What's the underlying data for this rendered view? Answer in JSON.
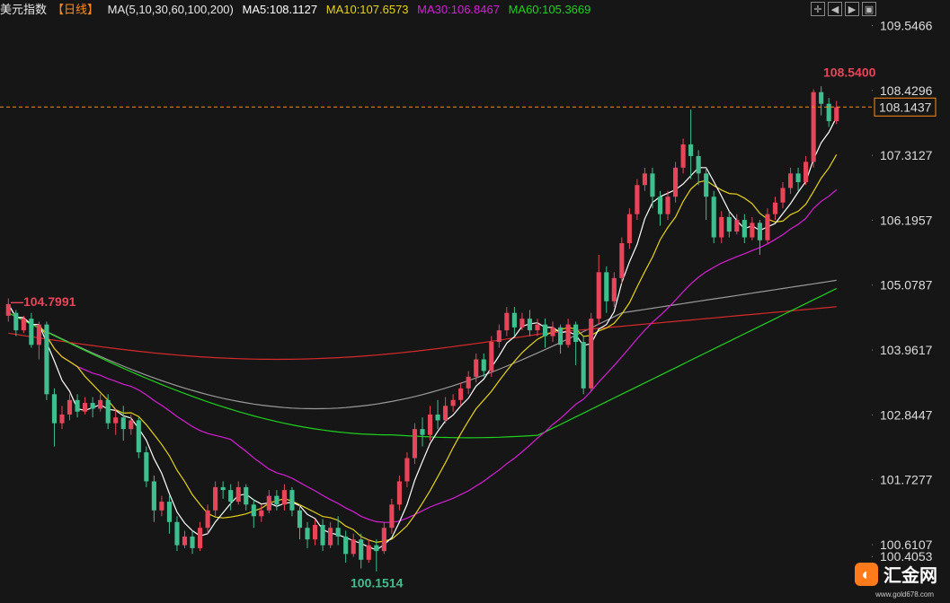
{
  "header": {
    "title": "美元指数",
    "period": "【日线】",
    "ma_label": "MA(5,10,30,60,100,200)",
    "ma5": "MA5:108.1127",
    "ma10": "MA10:107.6573",
    "ma30": "MA30:106.8467",
    "ma60": "MA60:105.3669",
    "colors": {
      "ma5": "#ffffff",
      "ma10": "#e6d21a",
      "ma30": "#d61fd6",
      "ma60": "#1fd11f"
    }
  },
  "toolbar": [
    "crosshair-icon",
    "bar-back-icon",
    "bar-forward-icon",
    "window-icon"
  ],
  "logo": {
    "name": "汇金网",
    "url": "www.gold678.com"
  },
  "chart_data": {
    "type": "candlestick",
    "yticks": [
      "109.5466",
      "108.4296",
      "107.3127",
      "106.1957",
      "105.0787",
      "103.9617",
      "102.8447",
      "101.7277",
      "100.6107",
      "100.4053"
    ],
    "ylim": [
      100.1,
      109.6
    ],
    "current_price": "108.1437",
    "annotations": {
      "high": "108.5400",
      "low": "100.1514",
      "left_high": "104.7991"
    },
    "colors": {
      "up": "#e8455a",
      "down": "#3fbf8f",
      "ma100": "#d42a2a",
      "ma200": "#9a9a9a",
      "price_line": "#ff8c1a"
    },
    "candles": [
      [
        104.55,
        104.75,
        104.45,
        104.85
      ],
      [
        104.6,
        104.3,
        104.2,
        104.65
      ],
      [
        104.3,
        104.5,
        104.25,
        104.55
      ],
      [
        104.5,
        104.05,
        104.0,
        104.6
      ],
      [
        104.05,
        104.4,
        103.8,
        104.45
      ],
      [
        104.4,
        103.2,
        103.1,
        104.45
      ],
      [
        103.2,
        102.7,
        102.3,
        103.3
      ],
      [
        102.7,
        102.85,
        102.6,
        103.0
      ],
      [
        102.85,
        103.1,
        102.75,
        103.2
      ],
      [
        103.1,
        102.9,
        102.8,
        103.2
      ],
      [
        102.9,
        103.05,
        102.85,
        103.15
      ],
      [
        103.05,
        102.95,
        102.8,
        103.15
      ],
      [
        102.95,
        103.1,
        102.9,
        103.2
      ],
      [
        103.1,
        102.7,
        102.6,
        103.2
      ],
      [
        102.7,
        102.8,
        102.5,
        102.95
      ],
      [
        102.8,
        102.6,
        102.4,
        103.0
      ],
      [
        102.6,
        102.75,
        102.5,
        102.85
      ],
      [
        102.75,
        102.2,
        102.1,
        102.8
      ],
      [
        102.2,
        101.7,
        101.6,
        102.3
      ],
      [
        101.7,
        101.2,
        101.0,
        101.8
      ],
      [
        101.2,
        101.35,
        101.1,
        101.45
      ],
      [
        101.35,
        101.0,
        100.8,
        101.45
      ],
      [
        101.0,
        100.6,
        100.5,
        101.1
      ],
      [
        100.6,
        100.75,
        100.55,
        100.85
      ],
      [
        100.75,
        100.55,
        100.45,
        100.85
      ],
      [
        100.55,
        100.9,
        100.5,
        101.0
      ],
      [
        100.9,
        101.2,
        100.8,
        101.3
      ],
      [
        101.2,
        101.6,
        101.1,
        101.7
      ],
      [
        101.6,
        101.55,
        101.4,
        101.7
      ],
      [
        101.55,
        101.35,
        101.2,
        101.65
      ],
      [
        101.35,
        101.6,
        101.3,
        101.7
      ],
      [
        101.6,
        101.3,
        101.2,
        101.65
      ],
      [
        101.3,
        101.1,
        100.9,
        101.4
      ],
      [
        101.1,
        101.2,
        101.0,
        101.3
      ],
      [
        101.2,
        101.45,
        101.15,
        101.55
      ],
      [
        101.45,
        101.3,
        101.2,
        101.55
      ],
      [
        101.3,
        101.55,
        101.2,
        101.65
      ],
      [
        101.55,
        101.2,
        101.1,
        101.6
      ],
      [
        101.2,
        100.9,
        100.7,
        101.3
      ],
      [
        100.9,
        100.7,
        100.55,
        101.0
      ],
      [
        100.7,
        100.95,
        100.6,
        101.05
      ],
      [
        100.95,
        100.6,
        100.5,
        101.05
      ],
      [
        100.6,
        100.9,
        100.55,
        101.0
      ],
      [
        100.9,
        100.75,
        100.6,
        101.1
      ],
      [
        100.75,
        100.45,
        100.3,
        100.85
      ],
      [
        100.45,
        100.7,
        100.4,
        100.8
      ],
      [
        100.7,
        100.35,
        100.2,
        100.8
      ],
      [
        100.35,
        100.6,
        100.3,
        100.7
      ],
      [
        100.6,
        100.5,
        100.15,
        100.7
      ],
      [
        100.5,
        100.9,
        100.45,
        101.0
      ],
      [
        100.9,
        101.3,
        100.8,
        101.4
      ],
      [
        101.3,
        101.7,
        101.2,
        101.8
      ],
      [
        101.7,
        102.1,
        101.6,
        102.2
      ],
      [
        102.1,
        102.6,
        102.0,
        102.7
      ],
      [
        102.6,
        102.5,
        102.3,
        102.8
      ],
      [
        102.5,
        102.85,
        102.4,
        103.0
      ],
      [
        102.85,
        102.75,
        102.6,
        103.1
      ],
      [
        102.75,
        103.0,
        102.7,
        103.15
      ],
      [
        103.0,
        103.1,
        102.9,
        103.2
      ],
      [
        103.1,
        103.3,
        103.0,
        103.4
      ],
      [
        103.3,
        103.5,
        103.2,
        103.6
      ],
      [
        103.5,
        103.8,
        103.4,
        103.9
      ],
      [
        103.8,
        103.6,
        103.5,
        103.9
      ],
      [
        103.6,
        104.1,
        103.5,
        104.2
      ],
      [
        104.1,
        104.3,
        104.0,
        104.4
      ],
      [
        104.3,
        104.6,
        104.2,
        104.7
      ],
      [
        104.6,
        104.35,
        104.2,
        104.7
      ],
      [
        104.35,
        104.5,
        104.3,
        104.6
      ],
      [
        104.5,
        104.3,
        104.2,
        104.65
      ],
      [
        104.3,
        104.4,
        104.2,
        104.5
      ],
      [
        104.4,
        104.2,
        104.0,
        104.5
      ],
      [
        104.2,
        104.35,
        104.1,
        104.45
      ],
      [
        104.35,
        104.05,
        103.9,
        104.4
      ],
      [
        104.05,
        104.4,
        104.0,
        104.5
      ],
      [
        104.4,
        104.1,
        103.7,
        104.45
      ],
      [
        104.1,
        103.3,
        103.2,
        104.2
      ],
      [
        103.3,
        104.5,
        103.25,
        104.6
      ],
      [
        104.5,
        105.3,
        104.4,
        105.6
      ],
      [
        105.3,
        104.8,
        104.6,
        105.4
      ],
      [
        104.8,
        105.2,
        104.7,
        105.3
      ],
      [
        105.2,
        105.8,
        105.1,
        105.9
      ],
      [
        105.8,
        106.3,
        105.7,
        106.4
      ],
      [
        106.3,
        106.8,
        106.2,
        106.9
      ],
      [
        106.8,
        107.0,
        106.7,
        107.1
      ],
      [
        107.0,
        106.6,
        106.4,
        107.1
      ],
      [
        106.6,
        106.3,
        106.1,
        106.7
      ],
      [
        106.3,
        106.6,
        106.2,
        106.7
      ],
      [
        106.6,
        107.1,
        106.5,
        107.2
      ],
      [
        107.1,
        107.5,
        107.0,
        107.6
      ],
      [
        107.5,
        107.3,
        106.9,
        108.1
      ],
      [
        107.3,
        107.0,
        106.8,
        107.4
      ],
      [
        107.0,
        106.6,
        106.2,
        107.1
      ],
      [
        106.6,
        105.9,
        105.8,
        106.7
      ],
      [
        105.9,
        106.25,
        105.8,
        106.35
      ],
      [
        106.25,
        106.0,
        105.9,
        106.35
      ],
      [
        106.0,
        106.2,
        105.95,
        106.3
      ],
      [
        106.2,
        105.9,
        105.8,
        106.3
      ],
      [
        105.9,
        106.15,
        105.85,
        106.25
      ],
      [
        106.15,
        105.85,
        105.6,
        106.2
      ],
      [
        105.85,
        106.3,
        105.8,
        106.4
      ],
      [
        106.3,
        106.5,
        106.2,
        106.6
      ],
      [
        106.5,
        106.75,
        106.4,
        106.85
      ],
      [
        106.75,
        107.0,
        106.65,
        107.1
      ],
      [
        107.0,
        106.85,
        106.7,
        107.1
      ],
      [
        106.85,
        107.2,
        106.8,
        107.3
      ],
      [
        107.2,
        108.4,
        107.1,
        108.45
      ],
      [
        108.4,
        108.2,
        108.0,
        108.5
      ],
      [
        108.2,
        107.9,
        107.8,
        108.3
      ],
      [
        107.9,
        108.14,
        107.85,
        108.25
      ]
    ]
  }
}
